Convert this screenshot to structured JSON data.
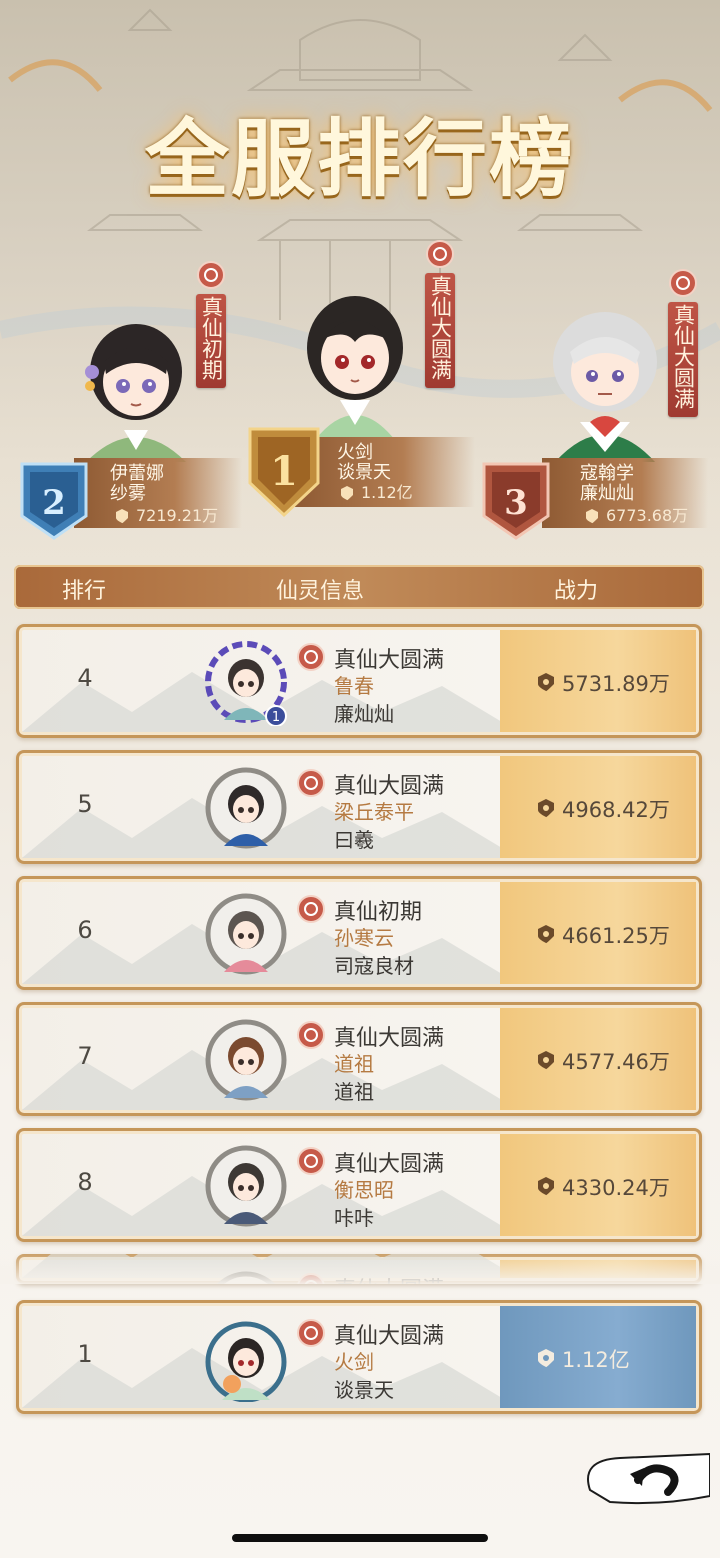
{
  "title": "全服排行榜",
  "podium": [
    {
      "place": "1",
      "realm": "真仙大圆满",
      "player": "火剑",
      "guild": "谈景天",
      "power": "1.12亿"
    },
    {
      "place": "2",
      "realm": "真仙初期",
      "player": "伊蕾娜",
      "guild": "纱雾",
      "power": "7219.21万"
    },
    {
      "place": "3",
      "realm": "真仙大圆满",
      "player": "寇翰学",
      "guild": "廉灿灿",
      "power": "6773.68万"
    }
  ],
  "table_header": {
    "rank": "排行",
    "info": "仙灵信息",
    "power": "战力"
  },
  "rows": [
    {
      "rank": "4",
      "realm": "真仙大圆满",
      "player": "鲁春",
      "guild": "廉灿灿",
      "power": "5731.89万",
      "badge": "1"
    },
    {
      "rank": "5",
      "realm": "真仙大圆满",
      "player": "梁丘泰平",
      "guild": "曰羲",
      "power": "4968.42万"
    },
    {
      "rank": "6",
      "realm": "真仙初期",
      "player": "孙寒云",
      "guild": "司寇良材",
      "power": "4661.25万"
    },
    {
      "rank": "7",
      "realm": "真仙大圆满",
      "player": "道祖",
      "guild": "道祖",
      "power": "4577.46万"
    },
    {
      "rank": "8",
      "realm": "真仙大圆满",
      "player": "衡思昭",
      "guild": "咔咔",
      "power": "4330.24万"
    },
    {
      "rank": "",
      "realm": "真仙大圆满",
      "player": "",
      "guild": "",
      "power": ""
    }
  ],
  "self_row": {
    "rank": "1",
    "realm": "真仙大圆满",
    "player": "火剑",
    "guild": "谈景天",
    "power": "1.12亿"
  },
  "colors": {
    "accent": "#b57a42",
    "gold_panel": "#f1c77d",
    "self_panel": "#7ca3c8",
    "banner_red": "#b14b3e"
  },
  "icons": [
    "seal-icon",
    "power-icon",
    "back-arrow-icon"
  ]
}
